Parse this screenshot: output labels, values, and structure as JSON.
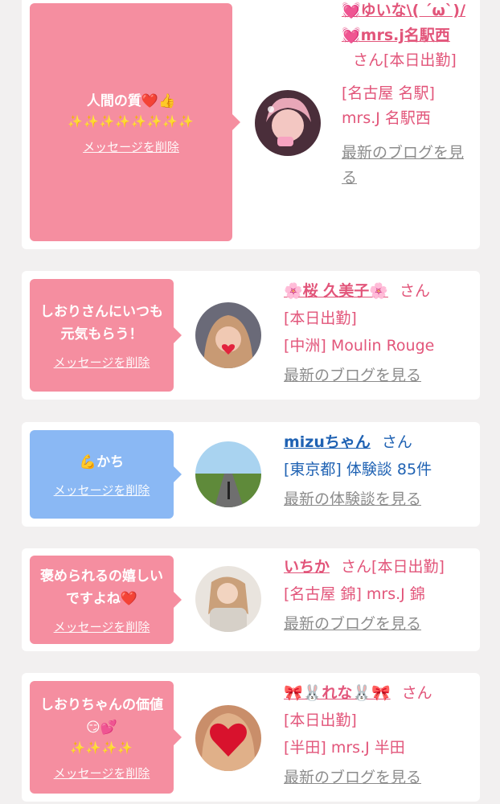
{
  "colors": {
    "bubble_pink": "#f58ea0",
    "bubble_blue": "#8ab8f4",
    "name_pink": "#e2557a",
    "name_blue": "#1f62b3",
    "link_gray": "#8c8c8c"
  },
  "messages": [
    {
      "bubble_text": "人間の質❤️👍",
      "sparkles": "✨✨✨✨✨✨✨✨",
      "delete_label": "メッセージを削除",
      "avatar_icon": "girl-selfie-photo",
      "user_name": "💓ゆいな\\( ´ω`)/💓mrs.j名駅西",
      "honorific": "さん",
      "status": "[本日出勤]",
      "area_shop": "[名古屋 名駅] mrs.J 名駅西",
      "detail": "",
      "link_label": "最新のブログを見る"
    },
    {
      "bubble_text": "しおりさんにいつも元気もらう！",
      "sparkles": "",
      "delete_label": "メッセージを削除",
      "avatar_icon": "girl-heart-photo",
      "user_name": "🌸桜 久美子🌸",
      "honorific": "さん",
      "status": "[本日出勤]",
      "area_shop": "[中洲] Moulin Rouge",
      "detail": "",
      "link_label": "最新のブログを見る"
    },
    {
      "bubble_text": "💪かち",
      "sparkles": "",
      "delete_label": "メッセージを削除",
      "avatar_icon": "road-landscape-photo",
      "user_name": "mizuちゃん",
      "honorific": "さん",
      "status": "",
      "area_shop": "[東京都] 体験談 85件",
      "detail": "",
      "link_label": "最新の体験談を見る"
    },
    {
      "bubble_text": "褒められるの嬉しいですよね❤️",
      "sparkles": "",
      "delete_label": "メッセージを削除",
      "avatar_icon": "girl-lace-photo",
      "user_name": "いちか",
      "honorific": "さん",
      "status": "[本日出勤]",
      "area_shop": "[名古屋 錦] mrs.J 錦",
      "detail": "",
      "link_label": "最新のブログを見る"
    },
    {
      "bubble_text": "しおりちゃんの価値😏💕",
      "sparkles": "✨✨✨✨",
      "delete_label": "メッセージを削除",
      "avatar_icon": "girl-big-heart-photo",
      "user_name": "🎀🐰れな🐰🎀",
      "honorific": "さん",
      "status": "[本日出勤]",
      "area_shop": "[半田] mrs.J 半田",
      "detail": "",
      "link_label": "最新のブログを見る"
    }
  ]
}
